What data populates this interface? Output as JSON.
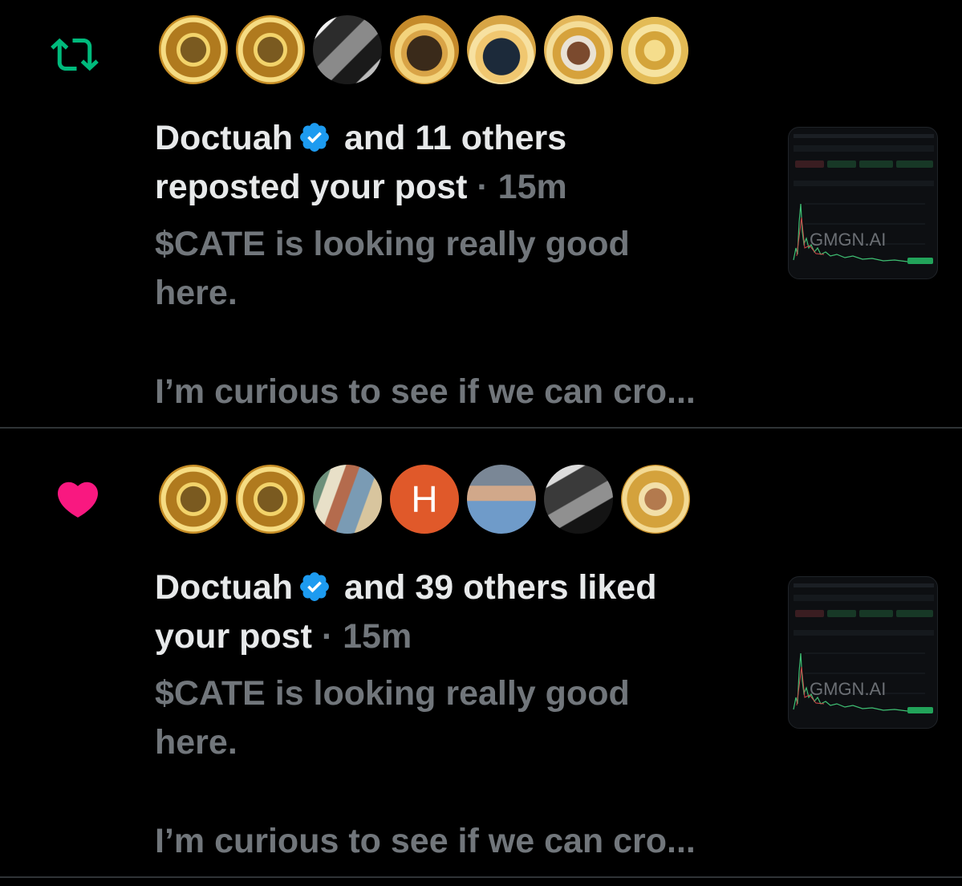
{
  "colors": {
    "background": "#000000",
    "text_primary": "#e7e9ea",
    "text_secondary": "#71767b",
    "repost_green": "#00ba7c",
    "like_pink": "#f91880",
    "verified_blue": "#1d9bf0",
    "divider": "#2f3336"
  },
  "notifications": [
    {
      "type": "repost",
      "icon": "repost-icon",
      "avatars": [
        "gold-coin-avatar",
        "gold-coin-avatar",
        "photo-avatar",
        "kd-avatar",
        "panther-avatar",
        "cat-avatar",
        "gold-coin-avatar"
      ],
      "user_name": "Doctuah",
      "verified": true,
      "headline_rest": " and 11 others",
      "headline_line2": "reposted your post",
      "time": " · 15m",
      "preview_line1": "$CATE is looking really good",
      "preview_line2": "here.",
      "preview_line3": "I’m curious to see if we can cro...",
      "thumbnail": {
        "watermark": "GMGN.AI",
        "tabs": [
          "1m",
          "5m",
          "1h",
          "24h"
        ],
        "intervals": "1s 15s 30s 1m 5m 15m 1h",
        "price_label": "Price/MCap"
      }
    },
    {
      "type": "like",
      "icon": "heart-icon",
      "avatars": [
        "gold-coin-avatar",
        "gold-coin-avatar",
        "photo-avatar",
        "letter-avatar",
        "photo-avatar",
        "photo-avatar",
        "gold-coin-avatar"
      ],
      "avatar_letter": "H",
      "user_name": "Doctuah",
      "verified": true,
      "headline_rest": " and 39 others liked",
      "headline_line2": "your post",
      "time": " · 15m",
      "preview_line1": "$CATE is looking really good",
      "preview_line2": "here.",
      "preview_line3": "I’m curious to see if we can cro...",
      "thumbnail": {
        "watermark": "GMGN.AI",
        "tabs": [
          "1m",
          "5m",
          "1h",
          "24h"
        ],
        "intervals": "1s 15s 30s 1m 5m 15m 1h",
        "price_label": "Price/MCap"
      }
    }
  ]
}
